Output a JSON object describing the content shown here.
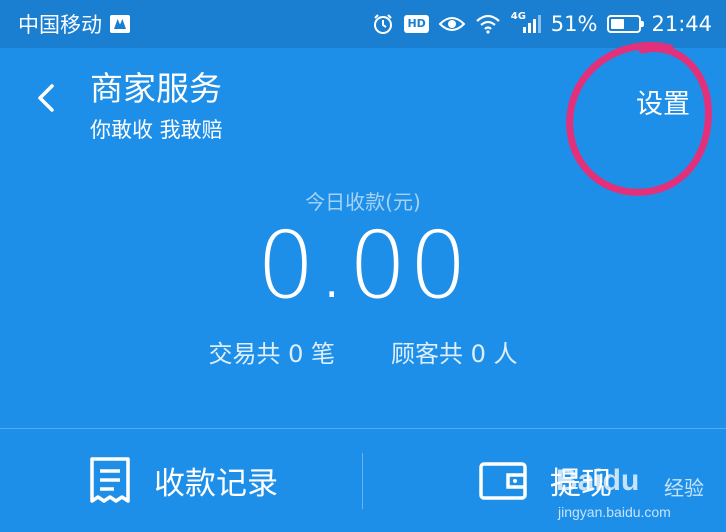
{
  "status_bar": {
    "carrier": "中国移动",
    "network": "4G",
    "battery": "51%",
    "battery_level": 0.51,
    "time": "21:44",
    "icons": [
      "carrier-logo-icon",
      "alarm-icon",
      "hd-badge",
      "eye-icon",
      "wifi-icon",
      "signal-icon",
      "battery-icon"
    ]
  },
  "header": {
    "title": "商家服务",
    "subtitle": "你敢收 我敢赔",
    "settings_label": "设置"
  },
  "summary": {
    "today_label": "今日收款(元)",
    "amount": "0.00",
    "transactions": "交易共 0 笔",
    "customers": "顾客共 0 人"
  },
  "bottom_bar": {
    "records_label": "收款记录",
    "withdraw_label": "提现"
  },
  "watermark": {
    "brand": "Baidu",
    "brand_sub": "经验",
    "url": "jingyan.baidu.com"
  },
  "colors": {
    "background": "#1e8fe8",
    "status_bar": "#1a7fd0",
    "highlight_circle": "#e2307a"
  }
}
